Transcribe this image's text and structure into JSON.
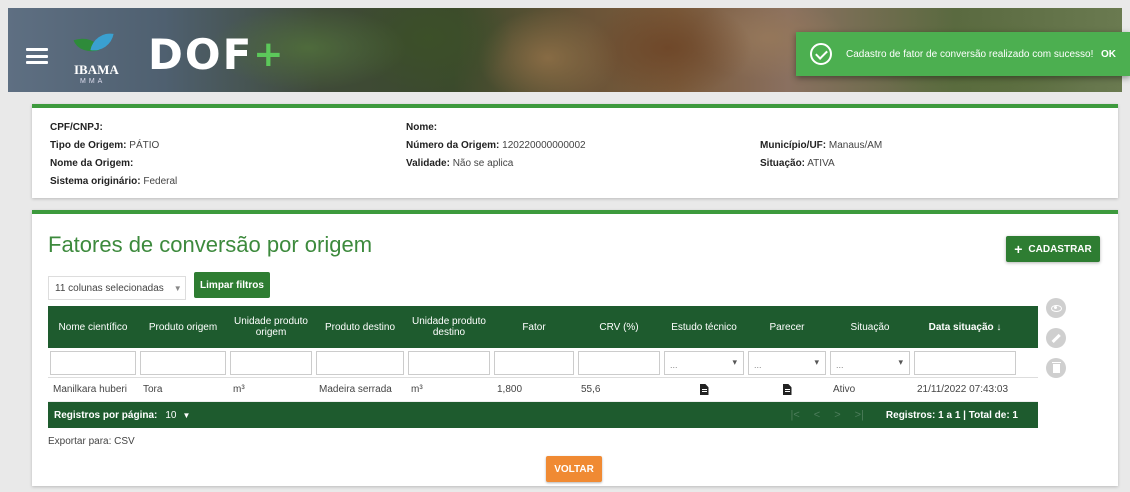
{
  "header": {
    "ibama_text": "IBAMA",
    "mma_text": "MMA",
    "dof_logo": "DOF+"
  },
  "toast": {
    "message": "Cadastro de fator de conversão realizado com sucesso!",
    "ok_label": "OK"
  },
  "info": {
    "cpf_label": "CPF/CNPJ:",
    "cpf_value": "",
    "nome_label": "Nome:",
    "nome_value": "",
    "tipo_label": "Tipo de Origem:",
    "tipo_value": "PÁTIO",
    "numero_label": "Número da Origem:",
    "numero_value": "120220000000002",
    "municipio_label": "Município/UF:",
    "municipio_value": "Manaus/AM",
    "nome_origem_label": "Nome da Origem:",
    "nome_origem_value": "",
    "validade_label": "Validade:",
    "validade_value": "Não se aplica",
    "situacao_label": "Situação:",
    "situacao_value": "ATIVA",
    "sistema_label": "Sistema originário:",
    "sistema_value": "Federal"
  },
  "main": {
    "title": "Fatores de conversão por origem",
    "cadastrar_label": "CADASTRAR",
    "column_selector": "11 colunas selecionadas",
    "limpar_label": "Limpar filtros",
    "export_label": "Exportar para: CSV",
    "voltar_label": "VOLTAR"
  },
  "grid": {
    "columns": [
      "Nome científico",
      "Produto origem",
      "Unidade produto origem",
      "Produto destino",
      "Unidade produto destino",
      "Fator",
      "CRV (%)",
      "Estudo técnico",
      "Parecer",
      "Situação",
      "Data situação ↓"
    ],
    "filter_dropdown_placeholder": "...",
    "rows": [
      {
        "nome": "Manilkara huberi",
        "produto_origem": "Tora",
        "unidade_origem": "m³",
        "produto_destino": "Madeira serrada",
        "unidade_destino": "m³",
        "fator": "1,800",
        "crv": "55,6",
        "situacao": "Ativo",
        "data": "21/11/2022 07:43:03"
      }
    ],
    "footer": {
      "rpp_label": "Registros por página:",
      "rpp_value": "10",
      "registros": "Registros: 1 a 1 | Total de: 1"
    }
  }
}
